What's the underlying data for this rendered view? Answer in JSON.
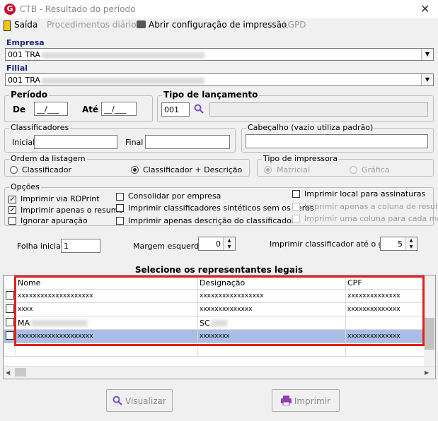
{
  "window": {
    "title": "CTB - Resultado do período",
    "app_icon": "G"
  },
  "toolbar": {
    "exit": "Saída",
    "daily": "Procedimentos diários",
    "print_config": "Abrir configuração de impressão",
    "lgpd": "LGPD"
  },
  "empresa": {
    "label": "Empresa",
    "value": "001 TRA"
  },
  "filial": {
    "label": "Filial",
    "value": "001 TRA"
  },
  "periodo": {
    "label": "Período",
    "de_label": "De",
    "de_value": "__/___",
    "ate_label": "Até",
    "ate_value": "__/___"
  },
  "tipo_lancamento": {
    "label": "Tipo de lançamento",
    "code": "001"
  },
  "classificadores": {
    "label": "Classificadores",
    "inicial": "Inicial",
    "final": "Final"
  },
  "cabecalho": {
    "label": "Cabeçalho (vazio utiliza padrão)"
  },
  "ordem": {
    "label": "Ordem da listagem",
    "opt1": "Classificador",
    "opt2": "Classificador + Descrição",
    "selected": "opt2"
  },
  "impressora": {
    "label": "Tipo de impressora",
    "opt1": "Matricial",
    "opt2": "Gráfica"
  },
  "opcoes": {
    "label": "Opções",
    "c1": "Imprimir via RDPrint",
    "c2": "Imprimir apenas o resumo",
    "c3": "Ignorar apuração",
    "c4": "Consolidar por empresa",
    "c5": "Imprimir classificadores sintéticos sem os zeros",
    "c6": "Imprimir apenas descrição do classificador",
    "c7": "Imprimir local para assinaturas",
    "c8": "Imprimir apenas a coluna de resultado",
    "c9": "Imprimir uma coluna para cada mês"
  },
  "folha": {
    "label": "Folha inicial",
    "value": "1"
  },
  "margem": {
    "label": "Margem esquerda",
    "value": "0"
  },
  "grau": {
    "label": "Imprimir classificador até o grau",
    "value": "5"
  },
  "reps": {
    "title": "Selecione os representantes legais",
    "headers": [
      "Nome",
      "Designação",
      "CPF"
    ],
    "rows": [
      [
        "xxxxxxxxxxxxxxxxxxxx",
        "xxxxxxxxxxxxxxxxx",
        "xxxxxxxxxxxxxx"
      ],
      [
        "xxxx",
        "xxxxxxxxxxxxxx",
        "xxxxxxxxxxxxxx"
      ],
      [
        "MA",
        "SC",
        ""
      ],
      [
        "xxxxxxxxxxxxxxxxxxxx",
        "xxxxxxxx",
        "xxxxxxxxxxxxxx"
      ]
    ]
  },
  "buttons": {
    "visualizar": "Visualizar",
    "imprimir": "Imprimir"
  }
}
